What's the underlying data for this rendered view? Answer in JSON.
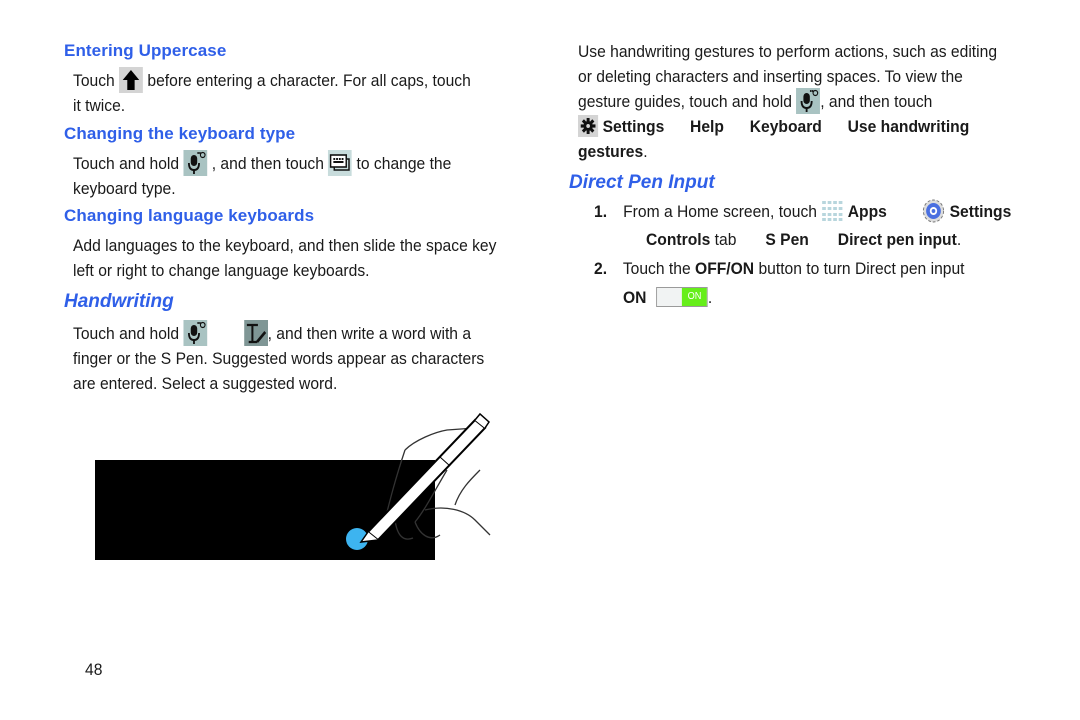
{
  "left": {
    "uppercase": {
      "heading": "Entering Uppercase",
      "line1_pre": "Touch",
      "line1_post": "before entering a character. For all caps, touch",
      "line2": "it twice."
    },
    "keyboard_type": {
      "heading": "Changing the keyboard type",
      "line1_pre": "Touch and hold",
      "line1_mid": ", and then touch",
      "line1_post": "to change the",
      "line2": "keyboard type."
    },
    "language": {
      "heading": "Changing language keyboards",
      "line1": "Add languages to the keyboard, and then slide the space key",
      "line2": "left or right to change language keyboards."
    },
    "handwriting": {
      "heading": "Handwriting",
      "line1_pre": "Touch and hold",
      "line1_post": ", and then write a word with a",
      "line2": "finger or the S Pen. Suggested words appear as characters",
      "line3": "are entered. Select a suggested word."
    }
  },
  "right": {
    "gestures": {
      "line1": "Use handwriting gestures to perform actions, such as editing",
      "line2": "or deleting characters and inserting spaces. To view the",
      "line3_pre": "gesture guides, touch and hold",
      "line3_post": ", and then touch",
      "path": [
        "Settings",
        "Help",
        "Keyboard",
        "Use handwriting"
      ],
      "path_end": "gestures",
      "period": "."
    },
    "direct_pen": {
      "heading": "Direct Pen Input",
      "steps": [
        {
          "number": "1.",
          "pre": "From a Home screen, touch",
          "apps": "Apps",
          "settings": "Settings",
          "controls": "Controls",
          "tab": "tab",
          "spen": "S Pen",
          "direct": "Direct pen input",
          "period": "."
        },
        {
          "number": "2.",
          "pre": "Touch the",
          "bold": "OFF/ON",
          "post": "button to turn Direct pen input",
          "on_label": "ON",
          "toggle_text": "ON",
          "toggle_state": "on",
          "period": "."
        }
      ]
    }
  },
  "page_number": "48",
  "colors": {
    "heading_blue": "#2f5fe8",
    "toggle_green": "#66ee1a",
    "touch_dot": "#3db4f0"
  }
}
